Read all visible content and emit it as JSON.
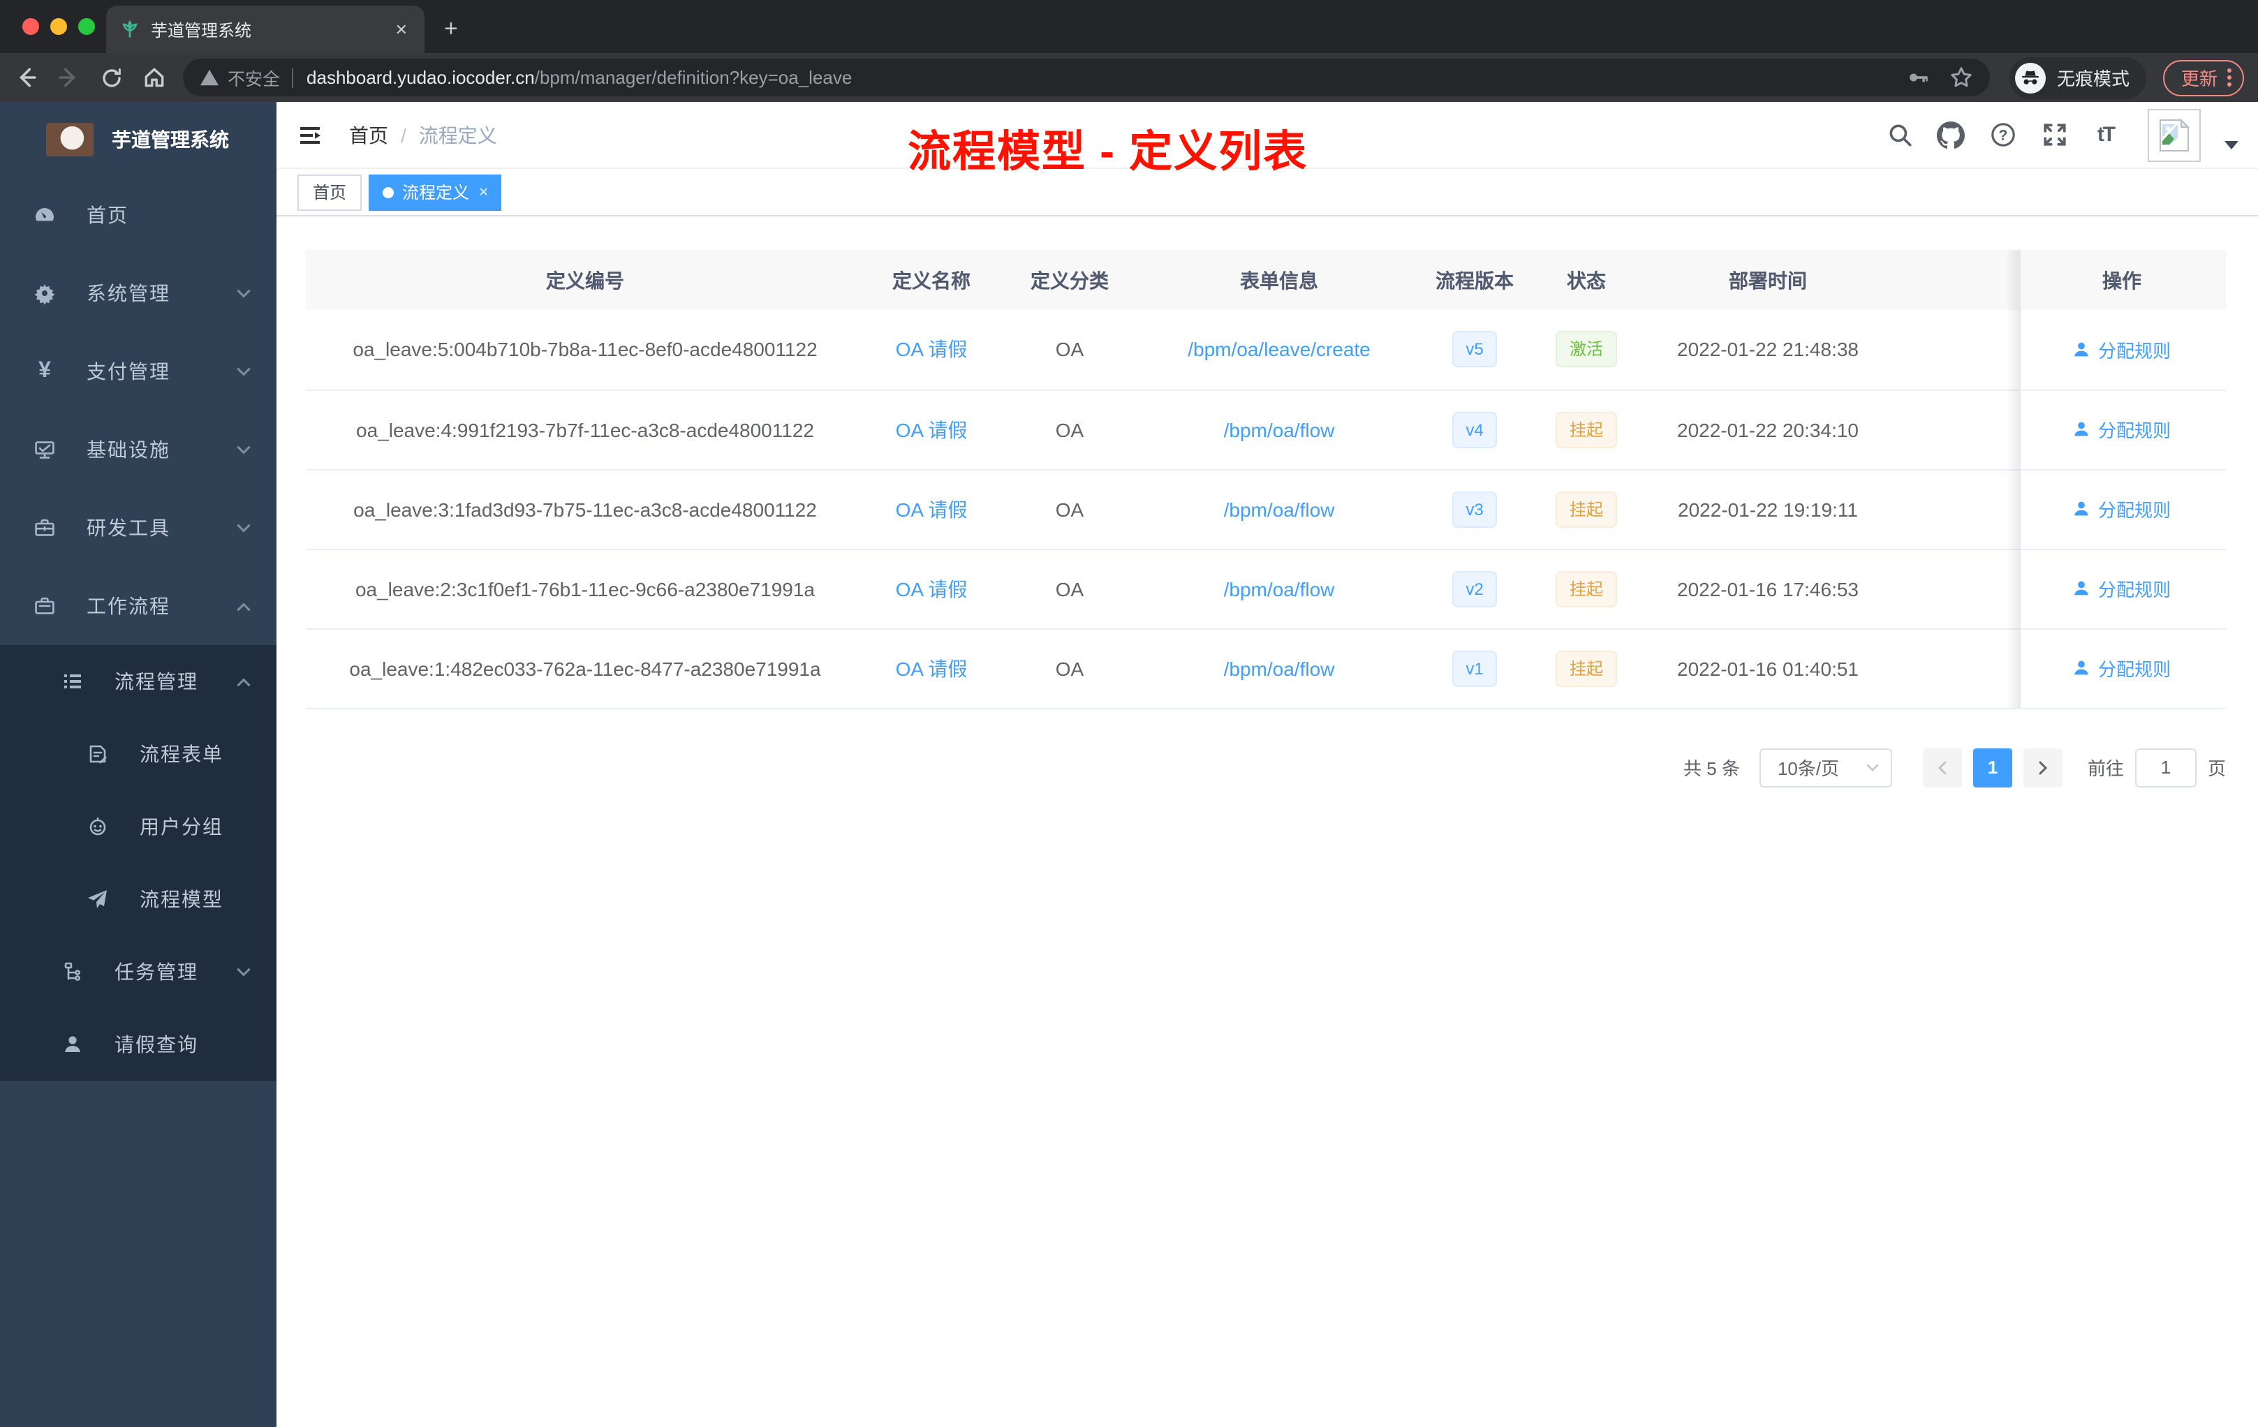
{
  "colors": {
    "accent": "#409eff",
    "active_green": "#67c23a",
    "suspended_orange": "#e6a23c",
    "annotation_red": "#ff1200",
    "sidebar_bg": "#304156",
    "submenu_bg": "#1f2d3d"
  },
  "browser": {
    "tab": {
      "title": "芋道管理系统",
      "close_glyph": "✕",
      "new_tab_glyph": "+"
    },
    "toolbar": {
      "security_label": "不安全",
      "url_host": "dashboard.yudao.iocoder.cn",
      "url_path": "/bpm/manager/definition?key=oa_leave",
      "incognito_label": "无痕模式",
      "update_label": "更新"
    }
  },
  "sidebar": {
    "app_title": "芋道管理系统",
    "items": [
      {
        "label": "首页"
      },
      {
        "label": "系统管理"
      },
      {
        "label": "支付管理"
      },
      {
        "label": "基础设施"
      },
      {
        "label": "研发工具"
      },
      {
        "label": "工作流程"
      },
      {
        "label": "流程管理"
      },
      {
        "label": "流程表单"
      },
      {
        "label": "用户分组"
      },
      {
        "label": "流程模型"
      },
      {
        "label": "任务管理"
      },
      {
        "label": "请假查询"
      }
    ]
  },
  "navbar": {
    "breadcrumb": {
      "home": "首页",
      "separator": "/",
      "current": "流程定义"
    },
    "annotation": "流程模型 - 定义列表"
  },
  "tags": {
    "items": [
      {
        "label": "首页"
      },
      {
        "label": "流程定义"
      }
    ],
    "close_glyph": "×"
  },
  "table": {
    "columns": [
      "定义编号",
      "定义名称",
      "定义分类",
      "表单信息",
      "流程版本",
      "状态",
      "部署时间",
      "操作"
    ],
    "rows": [
      {
        "id": "oa_leave:5:004b710b-7b8a-11ec-8ef0-acde48001122",
        "name": "OA 请假",
        "category": "OA",
        "form": "/bpm/oa/leave/create",
        "version": "v5",
        "status": "激活",
        "deploy_time": "2022-01-22 21:48:38",
        "action": "分配规则"
      },
      {
        "id": "oa_leave:4:991f2193-7b7f-11ec-a3c8-acde48001122",
        "name": "OA 请假",
        "category": "OA",
        "form": "/bpm/oa/flow",
        "version": "v4",
        "status": "挂起",
        "deploy_time": "2022-01-22 20:34:10",
        "action": "分配规则"
      },
      {
        "id": "oa_leave:3:1fad3d93-7b75-11ec-a3c8-acde48001122",
        "name": "OA 请假",
        "category": "OA",
        "form": "/bpm/oa/flow",
        "version": "v3",
        "status": "挂起",
        "deploy_time": "2022-01-22 19:19:11",
        "action": "分配规则"
      },
      {
        "id": "oa_leave:2:3c1f0ef1-76b1-11ec-9c66-a2380e71991a",
        "name": "OA 请假",
        "category": "OA",
        "form": "/bpm/oa/flow",
        "version": "v2",
        "status": "挂起",
        "deploy_time": "2022-01-16 17:46:53",
        "action": "分配规则"
      },
      {
        "id": "oa_leave:1:482ec033-762a-11ec-8477-a2380e71991a",
        "name": "OA 请假",
        "category": "OA",
        "form": "/bpm/oa/flow",
        "version": "v1",
        "status": "挂起",
        "deploy_time": "2022-01-16 01:40:51",
        "action": "分配规则"
      }
    ]
  },
  "pagination": {
    "total": "共 5 条",
    "page_size": "10条/页",
    "current_page": "1",
    "goto_label": "前往",
    "goto_value": "1",
    "page_unit": "页"
  }
}
